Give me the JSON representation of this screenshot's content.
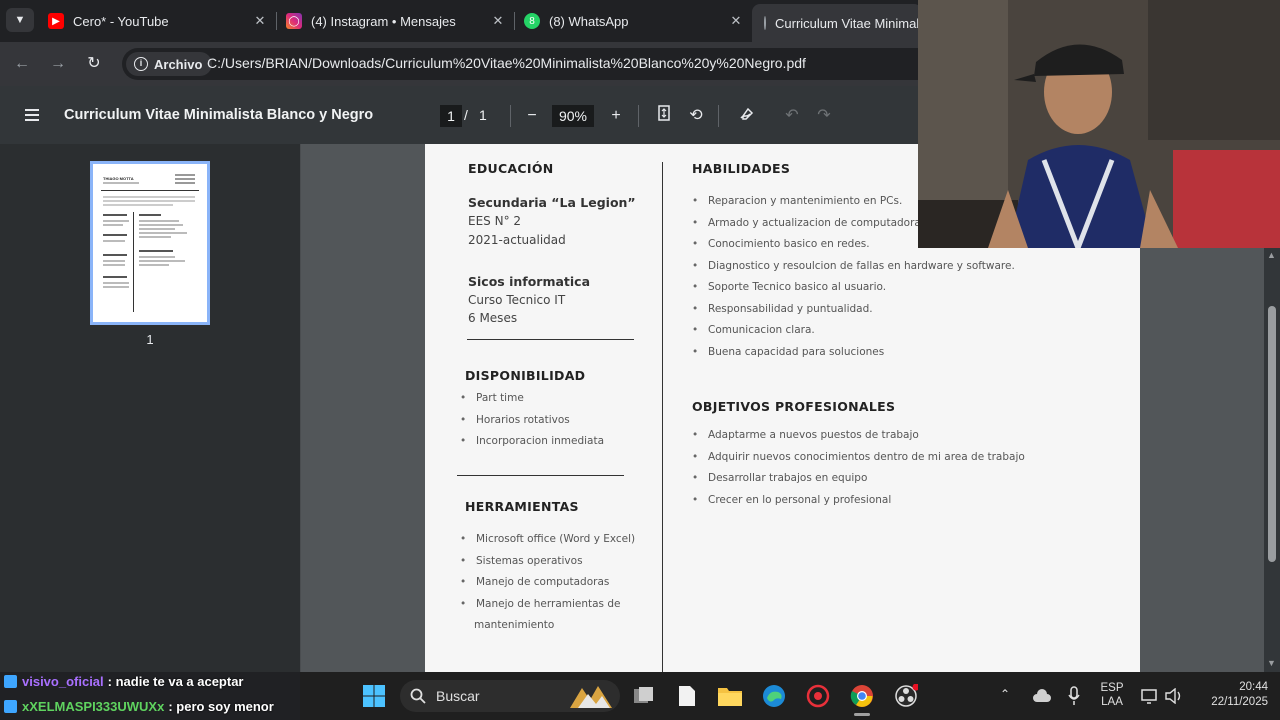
{
  "tabs": [
    {
      "title": "Cero* - YouTube",
      "icon": "youtube-icon",
      "color": "#ff0000"
    },
    {
      "title": "(4) Instagram • Mensajes",
      "icon": "instagram-icon",
      "color": "#d62976"
    },
    {
      "title": "(8) WhatsApp",
      "icon": "whatsapp-icon",
      "color": "#25d366"
    },
    {
      "title": "Curriculum Vitae Minimalista Blanco y Negro",
      "icon": "globe-icon",
      "color": "#9aa0a6"
    }
  ],
  "address": {
    "chip": "Archivo",
    "url": "C:/Users/BRIAN/Downloads/Curriculum%20Vitae%20Minimalista%20Blanco%20y%20Negro.pdf"
  },
  "pdf": {
    "title": "Curriculum Vitae Minimalista Blanco y Negro",
    "page_current": "1",
    "page_sep": "/",
    "page_total": "1",
    "zoom": "90%",
    "thumb_label": "1"
  },
  "cv": {
    "thumb_name": "THIAGO MOTTA",
    "education": {
      "title": "EDUCACIÓN",
      "entries": [
        {
          "school": "Secundaria “La Legion”",
          "line1": "EES N° 2",
          "line2": "2021-actualidad"
        },
        {
          "school": "Sicos informatica",
          "line1": "Curso Tecnico IT",
          "line2": "6 Meses"
        }
      ]
    },
    "availability": {
      "title": "DISPONIBILIDAD",
      "items": [
        "Part time",
        "Horarios rotativos",
        "Incorporacion inmediata"
      ]
    },
    "tools": {
      "title": "HERRAMIENTAS",
      "items": [
        "Microsoft office (Word y Excel)",
        "Sistemas operativos",
        "Manejo de computadoras",
        "Manejo de herramientas de",
        "mantenimiento"
      ]
    },
    "skills": {
      "title": "HABILIDADES",
      "items": [
        "Reparacion y mantenimiento en PCs.",
        "Armado y actualizacion de computadoras.",
        "Conocimiento basico en redes.",
        "Diagnostico y resoulcion de fallas en hardware y software.",
        "Soporte Tecnico basico al usuario.",
        "Responsabilidad y puntualidad.",
        "Comunicacion clara.",
        "Buena capacidad para soluciones"
      ]
    },
    "goals": {
      "title": "OBJETIVOS PROFESIONALES",
      "items": [
        "Adaptarme a nuevos puestos de trabajo",
        "Adquirir nuevos conocimientos dentro de mi area de trabajo",
        "Desarrollar trabajos en equipo",
        "Crecer en lo personal y profesional"
      ]
    }
  },
  "chat": [
    {
      "user": "visivo_oficial",
      "message": ": nadie te va a aceptar"
    },
    {
      "user": "xXELMASPI333UWUXx",
      "message": ": pero soy menor"
    }
  ],
  "taskbar": {
    "search_label": "Buscar",
    "lang_top": "ESP",
    "lang_bottom": "LAA",
    "time": "20:44",
    "date": "22/11/2025"
  }
}
